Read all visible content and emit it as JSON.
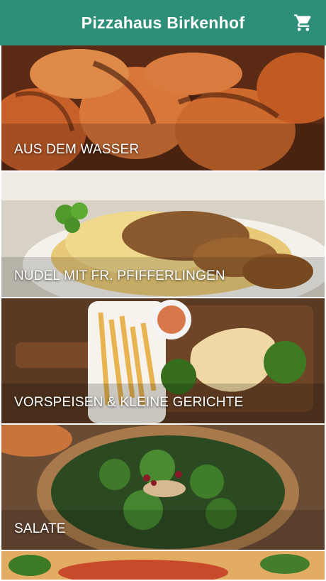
{
  "header": {
    "title": "Pizzahaus Birkenhof",
    "cart_icon": "cart-icon"
  },
  "categories": [
    {
      "label": "AUS DEM WASSER"
    },
    {
      "label": "NUDEL MIT FR. PFIFFERLINGEN"
    },
    {
      "label": "VORSPEISEN & KLEINE GERICHTE"
    },
    {
      "label": "SALATE"
    }
  ],
  "colors": {
    "header": "#2e8f78",
    "label": "#ffffff"
  }
}
